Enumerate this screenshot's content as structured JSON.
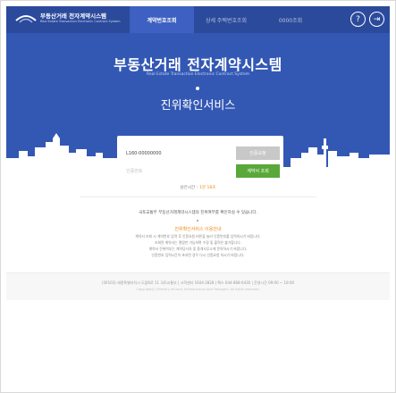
{
  "header": {
    "logo_title": "부동산거래 전자계약시스템",
    "logo_subtitle": "Real Estate Transaction Electronic Contract System",
    "tabs": [
      {
        "label": "계약번호조회",
        "active": true
      },
      {
        "label": "상세 주택번호조회",
        "active": false
      },
      {
        "label": "0000조회",
        "active": false
      }
    ],
    "help_icon": "?",
    "exit_icon": "⇥"
  },
  "hero": {
    "title": "부동산거래 전자계약시스템",
    "subtitle": "Real Estate Transaction Electronic Contract System",
    "service_title": "진위확인서비스"
  },
  "form": {
    "contract_no_value": "L160-00000000",
    "verify_placeholder": "인증번호",
    "request_button": "인증요청",
    "search_button": "계약서 조회"
  },
  "remaining": {
    "label": "남은시간 :",
    "time": "1분 18초"
  },
  "notice": {
    "line1": "국토교통부 부동산거래계약시스템의 진위여부를 확인하실 수 있습니다.",
    "guide_link": "진위확인서비스 이용안내",
    "desc_lines": [
      "계약서 조회 시 계약번호 입력 후 인증요청 버튼을 눌러 인증번호를 입력하시기 바랍니다.",
      "조회된 계약서는 열람만 가능하며 수정 및 출력은 불가합니다.",
      "계약서 진위여부는 계약당사자 및 중개사무소에 문의하시기 바랍니다.",
      "인증번호 입력시간이 초과된 경우 다시 인증요청 하시기 바랍니다."
    ]
  },
  "footer": {
    "line1": "(30103) 세종특별자치시 도움6로 11 국토교통부 | 고객센터 1644-2828 | 팩스 044-868-0430 | 운영시간 09:00 ~ 18:00",
    "line2": "Copyright(C) Ministry of Land, Infrastructure and Transport. All rights reserved."
  },
  "colors": {
    "header_bg": "#2b4a9c",
    "hero_bg": "#3358b4",
    "accent_green": "#58a83a",
    "accent_orange": "#e98c14"
  }
}
